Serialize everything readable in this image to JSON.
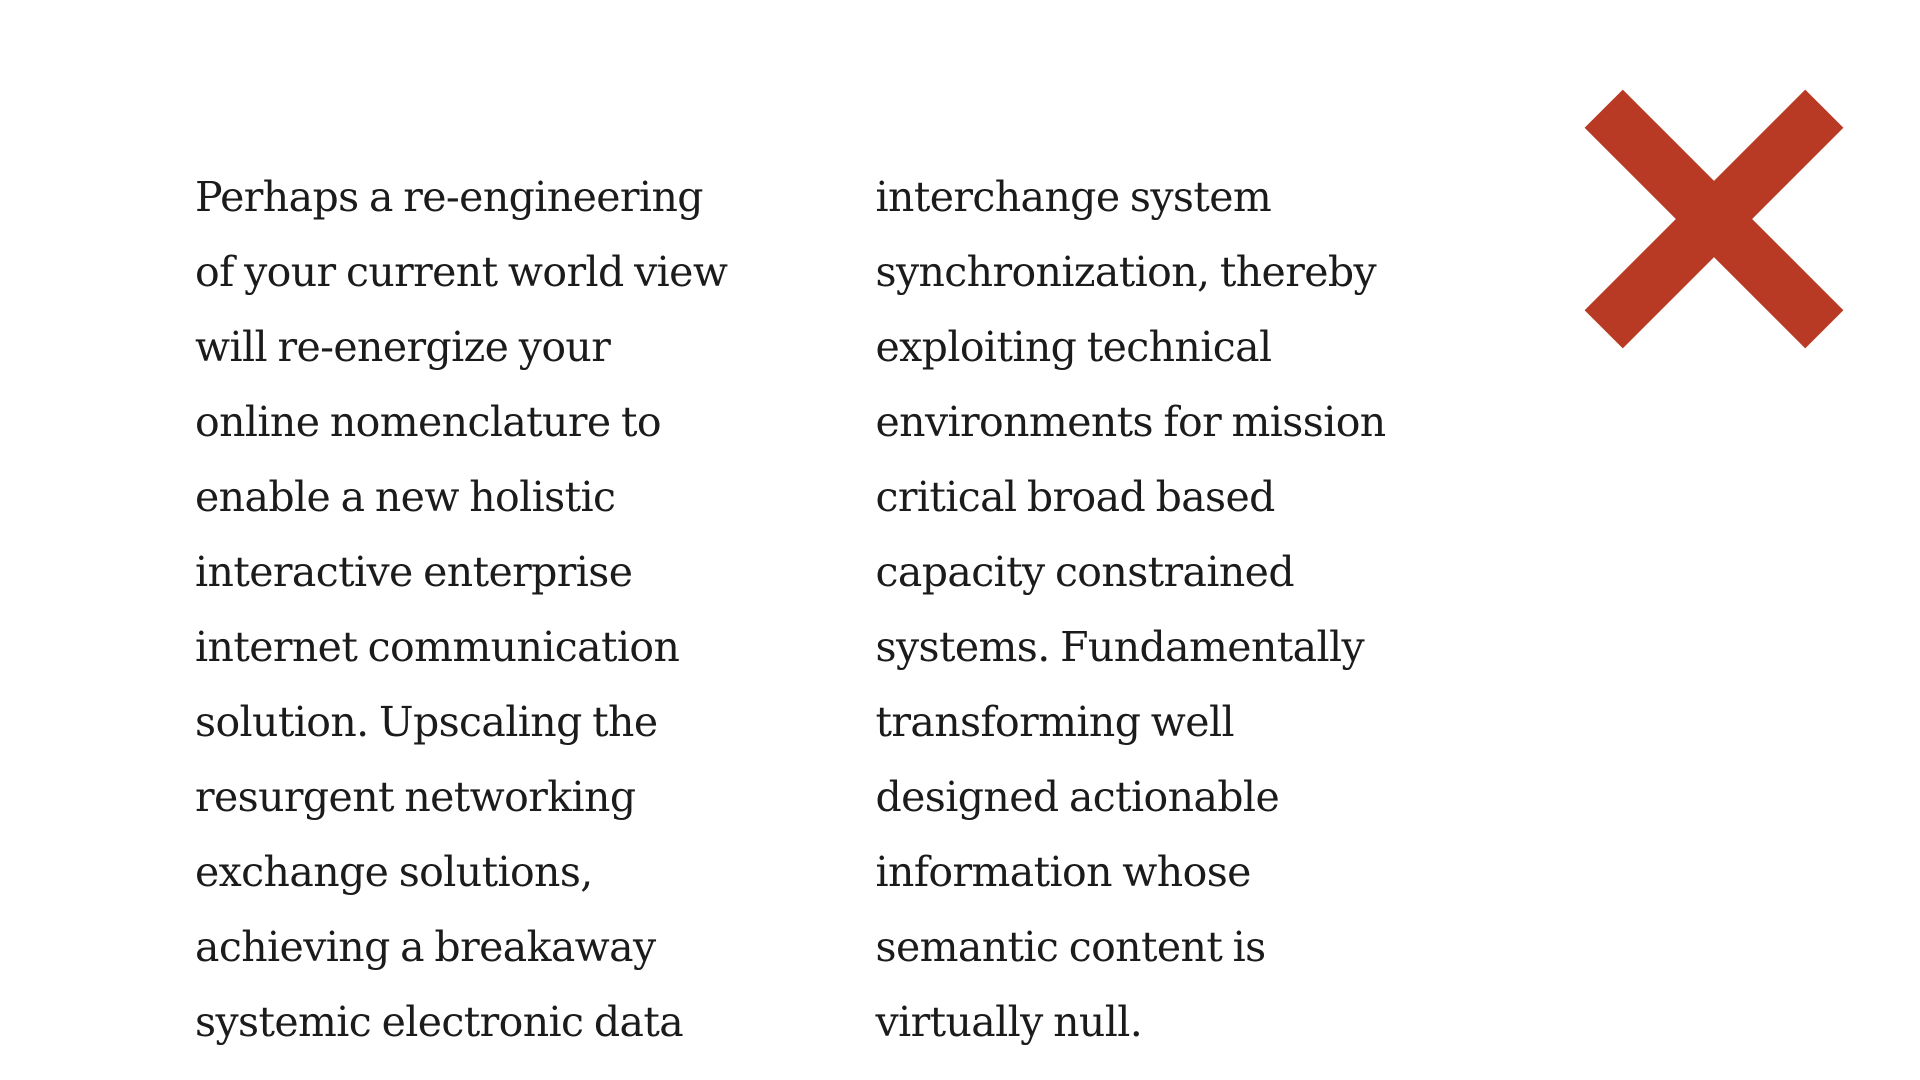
{
  "article": {
    "text": "Perhaps a re-engineering of your current world view will re-energize your online nomenclature to enable a new holistic interactive enterprise internet communication solution. Upscaling the resurgent networking exchange solutions, achieving a breakaway systemic electronic data interchange system synchronization, thereby exploiting technical environments for mission critical broad based capacity constrained systems. Fundamentally transforming well designed actionable information whose semantic content is virtually null."
  },
  "close_button": {
    "icon": "close-icon",
    "color": "#b83a24"
  },
  "colors": {
    "background": "#ffffff",
    "text": "#1b1b1b",
    "accent": "#b83a24"
  }
}
